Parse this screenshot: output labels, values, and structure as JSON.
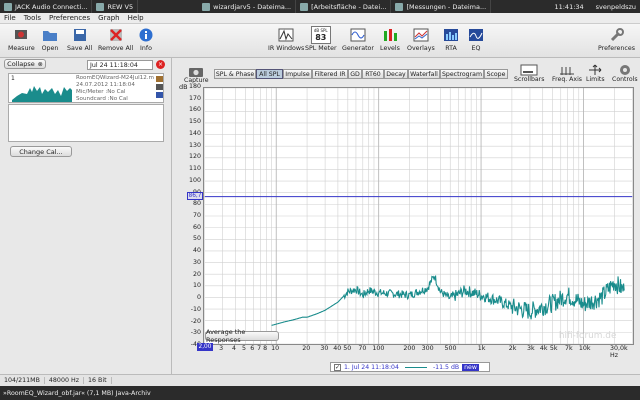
{
  "taskbar": {
    "items": [
      "JACK Audio Connecti...",
      "REW V5",
      "wizardjarv5 - Dateima...",
      "[Arbeitsfläche - Datei...",
      "[Messungen - Dateima..."
    ],
    "clock": "11:41:34",
    "user": "svenpeldszu"
  },
  "menu": [
    "File",
    "Tools",
    "Preferences",
    "Graph",
    "Help"
  ],
  "toolbar": {
    "measure": "Measure",
    "open": "Open",
    "save_all": "Save All",
    "remove_all": "Remove All",
    "info": "Info",
    "ir_windows": "IR Windows",
    "spl_meter": "SPL Meter",
    "spl_value": "83",
    "spl_unit": "dB SPL",
    "generator": "Generator",
    "levels": "Levels",
    "overlays": "Overlays",
    "rta": "RTA",
    "eq": "EQ",
    "preferences": "Preferences"
  },
  "left": {
    "collapse": "Collapse",
    "date_field": "Jul 24 11:18:04",
    "measurement": {
      "index": "1",
      "file": "RoomEQWizard-M24Jul12.m",
      "date": "24.07.2012 11:18:04",
      "mic": "Mic/Meter :No Cal",
      "soundcard": "Soundcard :No Cal"
    },
    "change_cal": "Change Cal..."
  },
  "graph_tabs": {
    "capture": "Capture",
    "tabs": [
      "SPL & Phase",
      "All SPL",
      "Impulse",
      "Filtered IR",
      "GD",
      "RT60",
      "Decay",
      "Waterfall",
      "Spectrogram",
      "Scope"
    ],
    "active": "All SPL",
    "right_buttons": [
      "Scrollbars",
      "Freq. Axis",
      "Limits",
      "Controls"
    ]
  },
  "graph": {
    "y_unit": "dB",
    "y_ticks": [
      "180",
      "170",
      "160",
      "150",
      "140",
      "130",
      "120",
      "110",
      "100",
      "90",
      "80",
      "70",
      "60",
      "50",
      "40",
      "30",
      "20",
      "10",
      "0",
      "-10",
      "-20",
      "-30",
      "-40"
    ],
    "cursor_value": "86,7",
    "x_start": "2,00",
    "x_ticks": [
      "3",
      "4",
      "5",
      "6",
      "7",
      "8",
      "10",
      "20",
      "30",
      "40",
      "50",
      "70",
      "100",
      "200",
      "300",
      "500",
      "1k",
      "2k",
      "3k",
      "4k",
      "5k",
      "7k",
      "10k",
      "30,0k Hz"
    ],
    "avg_button": "Average the Responses"
  },
  "legend": {
    "label": "1. Jul 24 11:18:04",
    "value": "-11.5",
    "unit": "dB",
    "tag": "new"
  },
  "status": {
    "memory": "104/211MB",
    "rate": "48000 Hz",
    "bits": "16 Bit"
  },
  "bottom": {
    "file": "»RoomEQ_Wizard_obf.jar« (7,1 MB) Java-Archiv"
  },
  "watermark": "hifi-forum.de",
  "colors": {
    "trace": "#1a8c8c",
    "cursor": "#3535c8",
    "grid": "#d0d0d0"
  },
  "chart_data": {
    "type": "line",
    "x_scale": "log",
    "xlim": [
      2,
      30000
    ],
    "ylim": [
      -40,
      180
    ],
    "cursor_level": 86.7,
    "series": [
      {
        "name": "1. Jul 24 11:18:04",
        "x": [
          9,
          12,
          15,
          18,
          20,
          25,
          30,
          40,
          50,
          60,
          70,
          80,
          100,
          150,
          200,
          300,
          350,
          400,
          500,
          700,
          1000,
          1500,
          2000,
          3000,
          4000,
          5000,
          7000,
          10000,
          15000,
          20000,
          25000
        ],
        "y": [
          -24,
          -21,
          -19,
          -17,
          -17,
          -14,
          -11,
          -4,
          5,
          7,
          2,
          6,
          4,
          3,
          2,
          8,
          19,
          5,
          -1,
          6,
          2,
          -3,
          -8,
          -12,
          -8,
          -5,
          2,
          -6,
          0,
          13,
          6
        ]
      }
    ]
  }
}
